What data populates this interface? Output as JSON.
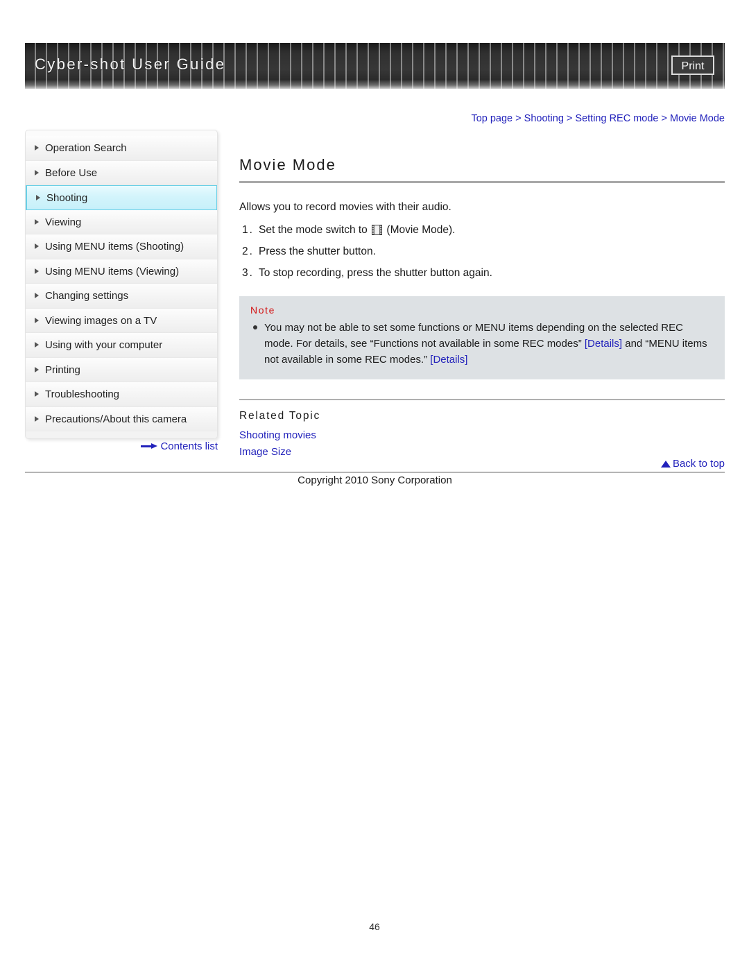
{
  "header": {
    "title": "Cyber-shot User Guide",
    "print_label": "Print"
  },
  "breadcrumb": {
    "text": "Top page > Shooting > Setting REC mode > Movie Mode"
  },
  "sidebar": {
    "items": [
      {
        "label": "Operation Search",
        "active": false
      },
      {
        "label": "Before Use",
        "active": false
      },
      {
        "label": "Shooting",
        "active": true
      },
      {
        "label": "Viewing",
        "active": false
      },
      {
        "label": "Using MENU items (Shooting)",
        "active": false
      },
      {
        "label": "Using MENU items (Viewing)",
        "active": false
      },
      {
        "label": "Changing settings",
        "active": false
      },
      {
        "label": "Viewing images on a TV",
        "active": false
      },
      {
        "label": "Using with your computer",
        "active": false
      },
      {
        "label": "Printing",
        "active": false
      },
      {
        "label": "Troubleshooting",
        "active": false
      },
      {
        "label": "Precautions/About this camera",
        "active": false
      }
    ],
    "contents_list_label": "Contents list"
  },
  "main": {
    "title": "Movie Mode",
    "lead": "Allows you to record movies with their audio.",
    "steps": [
      {
        "num": "1.",
        "before_icon": "Set the mode switch to ",
        "icon": "film-strip-icon",
        "after_icon": " (Movie Mode)."
      },
      {
        "num": "2.",
        "before_icon": "Press the shutter button.",
        "icon": "",
        "after_icon": ""
      },
      {
        "num": "3.",
        "before_icon": "To stop recording, press the shutter button again.",
        "icon": "",
        "after_icon": ""
      }
    ],
    "note": {
      "label": "Note",
      "part1": "You may not be able to set some functions or MENU items depending on the selected REC mode. For details, see “Functions not available in some REC modes” ",
      "link1": "[Details]",
      "part2": " and “MENU items not available in some REC modes.” ",
      "link2": "[Details]"
    },
    "related": {
      "title": "Related Topic",
      "links": [
        "Shooting movies",
        "Image Size"
      ]
    },
    "back_to_top_label": "Back to top"
  },
  "footer": {
    "copyright": "Copyright 2010 Sony Corporation",
    "page_number": "46"
  },
  "colors": {
    "link_blue": "#2222bb",
    "note_red": "#d31414",
    "note_bg": "#dde1e4",
    "active_nav": "#c7f0fa"
  }
}
